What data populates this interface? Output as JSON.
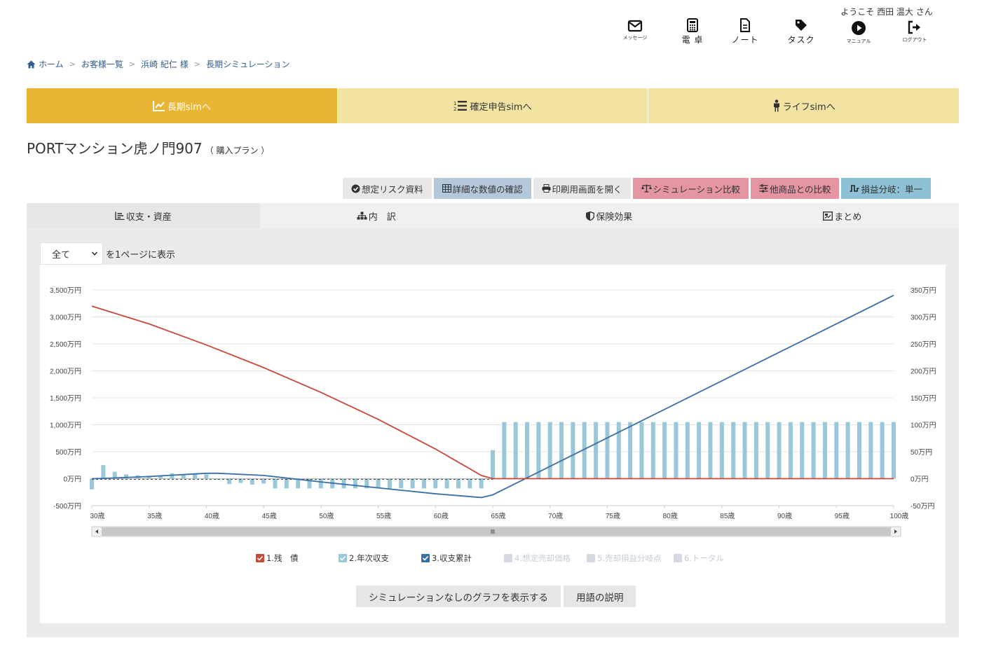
{
  "header": {
    "welcome": "ようこそ 西田 温大 さん",
    "icons": [
      {
        "icon": "envelope-icon",
        "label": "メッセージ",
        "size": "small"
      },
      {
        "icon": "calculator-icon",
        "label": "電 卓",
        "size": "big"
      },
      {
        "icon": "note-icon",
        "label": "ノート",
        "size": "big"
      },
      {
        "icon": "tag-icon",
        "label": "タスク",
        "size": "big"
      },
      {
        "icon": "play-icon",
        "label": "マニュアル",
        "size": "small"
      },
      {
        "icon": "logout-icon",
        "label": "ログアウト",
        "size": "small"
      }
    ]
  },
  "breadcrumb": {
    "home": "ホーム",
    "items": [
      "お客様一覧",
      "浜崎 紀仁 様",
      "長期シミュレーション"
    ],
    "separator": ">"
  },
  "sim_tabs": [
    {
      "label": "長期simへ",
      "active": true
    },
    {
      "label": "確定申告simへ",
      "active": false
    },
    {
      "label": "ライフsimへ",
      "active": false
    }
  ],
  "page": {
    "title": "PORTマンション虎ノ門907",
    "subtitle": "（ 購入プラン ）"
  },
  "actions": [
    {
      "label": "想定リスク資料",
      "color": "#e8e8e8"
    },
    {
      "label": "詳細な数値の確認",
      "color": "#b4c8dc"
    },
    {
      "label": "印刷用画面を開く",
      "color": "#e8e8e8"
    },
    {
      "label": "シミュレーション比較",
      "color": "#e595a2"
    },
    {
      "label": "他商品との比較",
      "color": "#e595a2"
    },
    {
      "label": "損益分岐：単一",
      "color": "#8fc1d6"
    }
  ],
  "view_tabs": [
    {
      "label": "収支・資産",
      "active": true
    },
    {
      "label": "内　訳",
      "active": false
    },
    {
      "label": "保険効果",
      "active": false
    },
    {
      "label": "まとめ",
      "active": false
    }
  ],
  "pager": {
    "selected": "全て",
    "suffix": "を1ページに表示"
  },
  "chart_data": {
    "type": "bar",
    "x_labels": [
      "30歳",
      "35歳",
      "40歳",
      "45歳",
      "50歳",
      "55歳",
      "60歳",
      "65歳",
      "70歳",
      "75歳",
      "80歳",
      "85歳",
      "90歳",
      "95歳",
      "100歳"
    ],
    "x_range": [
      30,
      100
    ],
    "y_left": {
      "ticks": [
        "3,500万円",
        "3,000万円",
        "2,500万円",
        "2,000万円",
        "1,500万円",
        "1,000万円",
        "500万円",
        "0万円",
        "-500万円"
      ],
      "range": [
        -500,
        3500
      ],
      "unit": "万円"
    },
    "y_right": {
      "ticks": [
        "350万円",
        "300万円",
        "250万円",
        "200万円",
        "150万円",
        "100万円",
        "50万円",
        "0万円",
        "-50万円"
      ],
      "range": [
        -50,
        350
      ],
      "unit": "万円"
    },
    "grid": true,
    "colors": {
      "debt": "#c9483a",
      "annual": "#9ac8d9",
      "cumulative": "#3a6fa5"
    },
    "series": [
      {
        "name": "1.残　債",
        "axis": "left",
        "type": "line",
        "x": [
          30,
          35,
          40,
          45,
          50,
          55,
          60,
          64,
          65,
          100
        ],
        "values": [
          3200,
          2870,
          2480,
          2060,
          1600,
          1100,
          550,
          60,
          0,
          0
        ]
      },
      {
        "name": "2.年次収支",
        "axis": "right",
        "type": "bar",
        "x": [
          30,
          31,
          32,
          33,
          34,
          35,
          36,
          37,
          38,
          39,
          40,
          41,
          42,
          43,
          44,
          45,
          46,
          47,
          48,
          49,
          50,
          51,
          52,
          53,
          54,
          55,
          56,
          57,
          58,
          59,
          60,
          61,
          62,
          63,
          64,
          65,
          66,
          67,
          68,
          69,
          70,
          71,
          72,
          73,
          74,
          75,
          76,
          77,
          78,
          79,
          80,
          81,
          82,
          83,
          84,
          85,
          86,
          87,
          88,
          89,
          90,
          91,
          92,
          93,
          94,
          95,
          96,
          97,
          98,
          99,
          100
        ],
        "values": [
          -20,
          25,
          13,
          8,
          6,
          5,
          6,
          10,
          8,
          10,
          8,
          -2,
          -10,
          -8,
          -11,
          -9,
          -18,
          -18,
          -18,
          -18,
          -18,
          -18,
          -18,
          -18,
          -18,
          -18,
          -18,
          -18,
          -18,
          -18,
          -18,
          -18,
          -18,
          -18,
          -18,
          53,
          105,
          105,
          105,
          105,
          105,
          105,
          105,
          105,
          105,
          105,
          105,
          105,
          105,
          105,
          105,
          105,
          105,
          105,
          105,
          105,
          105,
          105,
          105,
          105,
          105,
          105,
          105,
          105,
          105,
          105,
          105,
          105,
          105,
          105,
          105
        ]
      },
      {
        "name": "3.収支累計",
        "axis": "left",
        "type": "line",
        "x": [
          30,
          31,
          35,
          40,
          41,
          45,
          50,
          55,
          60,
          64,
          65,
          100
        ],
        "values": [
          0,
          5,
          40,
          100,
          100,
          60,
          -60,
          -170,
          -280,
          -350,
          -300,
          3400
        ]
      }
    ],
    "legend": [
      {
        "label": "1.残　債",
        "color": "#c9483a",
        "enabled": true
      },
      {
        "label": "2.年次収支",
        "color": "#9ac8d9",
        "enabled": true
      },
      {
        "label": "3.収支累計",
        "color": "#3a6fa5",
        "enabled": true
      },
      {
        "label": "4.想定売却価格",
        "color": "#d5dae2",
        "enabled": false
      },
      {
        "label": "5.売却損益分岐点",
        "color": "#d5dae2",
        "enabled": false
      },
      {
        "label": "6.トータル",
        "color": "#d5dae2",
        "enabled": false
      }
    ]
  },
  "bottom_buttons": [
    "シミュレーションなしのグラフを表示する",
    "用語の説明"
  ]
}
